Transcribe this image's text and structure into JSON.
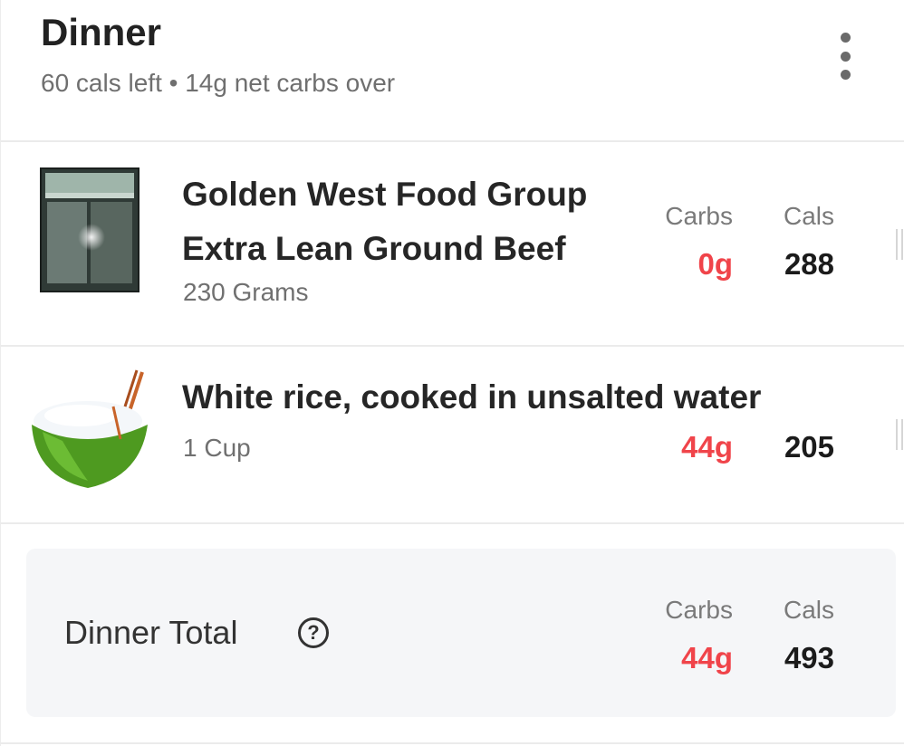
{
  "meal": {
    "title": "Dinner",
    "summary": "60 cals left • 14g net carbs over"
  },
  "columns": {
    "carbs": "Carbs",
    "cals": "Cals"
  },
  "foods": [
    {
      "name": "Golden West Food Group Extra Lean Ground Beef",
      "quantity": "230 Grams",
      "carbs": "0g",
      "cals": "288",
      "image": "ground-beef-package-photo"
    },
    {
      "name": "White rice, cooked in unsalted water",
      "quantity": "1 Cup",
      "carbs": "44g",
      "cals": "205",
      "image": "rice-bowl-icon"
    }
  ],
  "total": {
    "label": "Dinner Total",
    "help": "?",
    "carbs": "44g",
    "cals": "493"
  },
  "colors": {
    "carbs_value": "#f0444a",
    "cals_value": "#1b1b1b",
    "total_background": "#f5f6f8"
  }
}
